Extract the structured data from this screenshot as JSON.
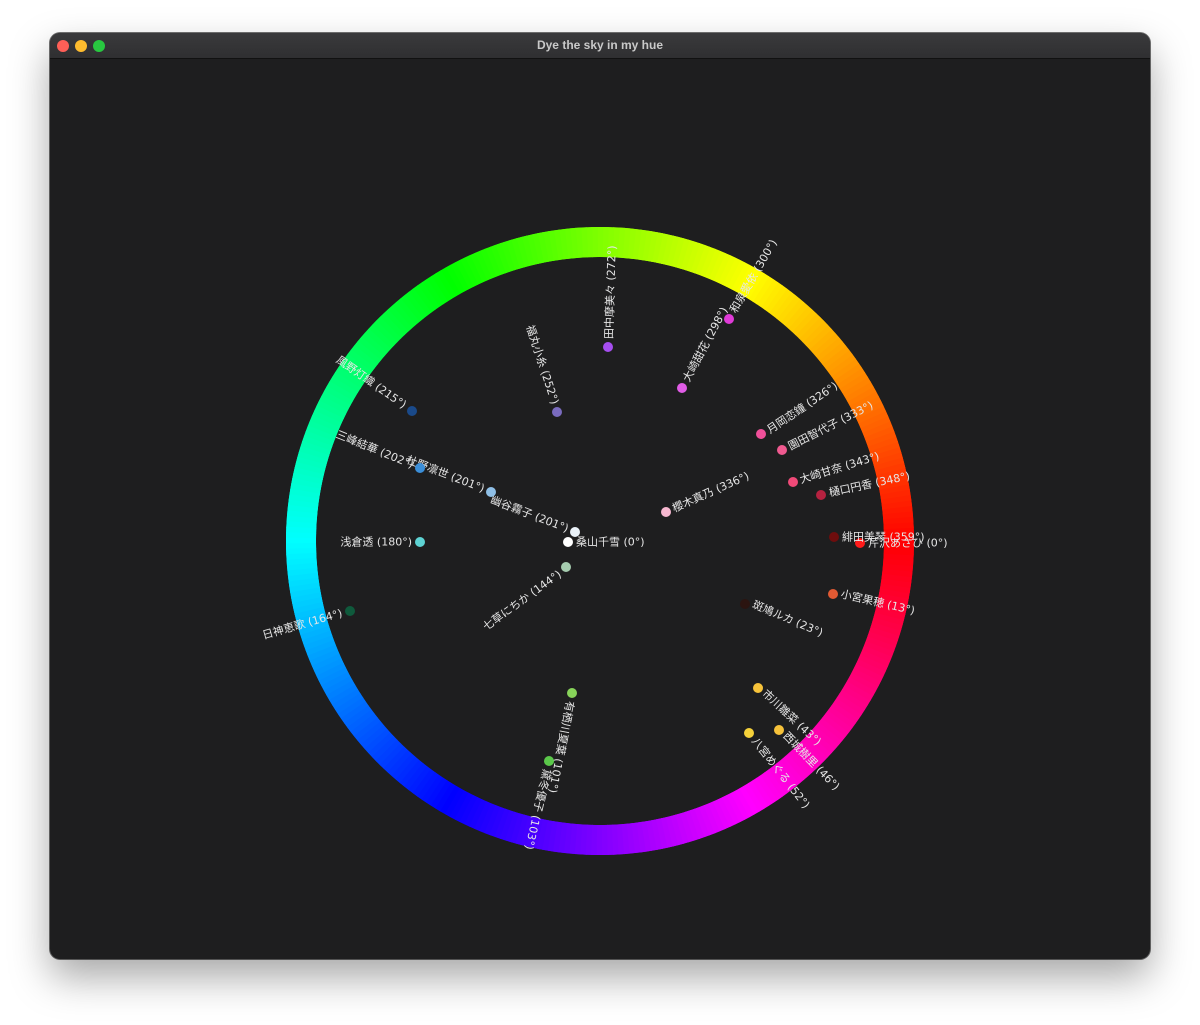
{
  "window": {
    "title": "Dye the sky in my hue",
    "buttons": {
      "close_color": "#ff5f57",
      "minimize_color": "#febc2e",
      "maximize_color": "#28c840"
    }
  },
  "wheel": {
    "label_color": "#e6e6e6",
    "points": [
      {
        "label": "桑山千雪 (0°)",
        "color": "#ffffff",
        "hue": 0
      },
      {
        "label": "芹沢あさひ (0°)",
        "color": "#ff1a1a",
        "hue": 0
      },
      {
        "label": "緋田美琴 (359°)",
        "color": "#6e0d0d",
        "hue": 359
      },
      {
        "label": "小宮果穂 (13°)",
        "color": "#e25a33",
        "hue": 13
      },
      {
        "label": "斑鳩ルカ (23°)",
        "color": "#2b1410",
        "hue": 23
      },
      {
        "label": "市川雛菜 (43°)",
        "color": "#f7c33a",
        "hue": 43
      },
      {
        "label": "西城樹里 (46°)",
        "color": "#f6c23a",
        "hue": 46
      },
      {
        "label": "八宮めぐる (52°)",
        "color": "#f5d13a",
        "hue": 52
      },
      {
        "label": "有栖川夏葉 (101°)",
        "color": "#88d45a",
        "hue": 101
      },
      {
        "label": "黛冬優子 (103°)",
        "color": "#5bc84a",
        "hue": 103
      },
      {
        "label": "七草にちか (144°)",
        "color": "#a6ccaf",
        "hue": 144
      },
      {
        "label": "日神恵歌 (164°)",
        "color": "#0f5a3c",
        "hue": 164
      },
      {
        "label": "浅倉透 (180°)",
        "color": "#5ed3d3",
        "hue": 180
      },
      {
        "label": "幽谷霧子 (201°)",
        "color": "#eaf2f8",
        "hue": 201
      },
      {
        "label": "杜野凛世 (201°)",
        "color": "#8fbfe6",
        "hue": 201
      },
      {
        "label": "三峰結華 (202°)",
        "color": "#3b8ed8",
        "hue": 202
      },
      {
        "label": "風野灯織 (215°)",
        "color": "#1a4a8a",
        "hue": 215
      },
      {
        "label": "福丸小糸 (252°)",
        "color": "#7a6bbf",
        "hue": 252
      },
      {
        "label": "田中摩美々 (272°)",
        "color": "#a64ef0",
        "hue": 272
      },
      {
        "label": "大崎甜花 (298°)",
        "color": "#e05ce6",
        "hue": 298
      },
      {
        "label": "和泉愛依 (300°)",
        "color": "#e03bd8",
        "hue": 300
      },
      {
        "label": "月岡恋鐘 (326°)",
        "color": "#f0509a",
        "hue": 326
      },
      {
        "label": "園田智代子 (333°)",
        "color": "#f05a90",
        "hue": 333
      },
      {
        "label": "大崎甘奈 (343°)",
        "color": "#f04a78",
        "hue": 343
      },
      {
        "label": "樋口円香 (348°)",
        "color": "#b52240",
        "hue": 348
      },
      {
        "label": "櫻木真乃 (336°)",
        "color": "#f7b8d0",
        "hue": 336
      }
    ]
  }
}
